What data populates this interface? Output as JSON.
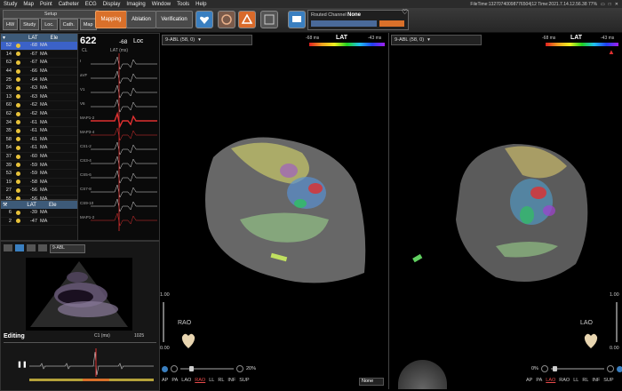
{
  "menu": [
    "Study",
    "Map",
    "Point",
    "Catheter",
    "ECG",
    "Display",
    "Imaging",
    "Window",
    "Tools",
    "Help"
  ],
  "status": {
    "file_time": "FileTime:13270740098776504|12 Time:2021.7.14.12.56.38 77%"
  },
  "toolbar": {
    "setup": "Setup",
    "tabs": [
      "HW",
      "Study",
      "Loc.",
      "Cath.",
      "Map"
    ],
    "mapping": "Mapping",
    "ablation": "Ablation",
    "verification": "Verification",
    "routed_channel_label": "Routed Channel",
    "routed_channel_value": "None"
  },
  "list": {
    "headers": [
      "LAT",
      "Ele"
    ],
    "rows": [
      {
        "n": "52",
        "v": "-68",
        "t": "MA",
        "sel": true
      },
      {
        "n": "14",
        "v": "-67",
        "t": "MA"
      },
      {
        "n": "63",
        "v": "-67",
        "t": "MA"
      },
      {
        "n": "44",
        "v": "-66",
        "t": "MA"
      },
      {
        "n": "25",
        "v": "-64",
        "t": "MA"
      },
      {
        "n": "26",
        "v": "-63",
        "t": "MA"
      },
      {
        "n": "13",
        "v": "-63",
        "t": "MA"
      },
      {
        "n": "60",
        "v": "-62",
        "t": "MA"
      },
      {
        "n": "62",
        "v": "-62",
        "t": "MA"
      },
      {
        "n": "34",
        "v": "-61",
        "t": "MA"
      },
      {
        "n": "35",
        "v": "-61",
        "t": "MA"
      },
      {
        "n": "58",
        "v": "-61",
        "t": "MA"
      },
      {
        "n": "54",
        "v": "-61",
        "t": "MA"
      },
      {
        "n": "37",
        "v": "-60",
        "t": "MA"
      },
      {
        "n": "39",
        "v": "-59",
        "t": "MA"
      },
      {
        "n": "53",
        "v": "-59",
        "t": "MA"
      },
      {
        "n": "19",
        "v": "-58",
        "t": "MA"
      },
      {
        "n": "27",
        "v": "-56",
        "t": "MA"
      },
      {
        "n": "55",
        "v": "-56",
        "t": "MA"
      }
    ],
    "rows2": [
      {
        "n": "6",
        "v": "-39",
        "t": "MA"
      },
      {
        "n": "2",
        "v": "-47",
        "t": "MA"
      }
    ]
  },
  "ecg": {
    "cl": "622",
    "cl_label": "CL",
    "lat": "-68",
    "lat_label": "LAT (ms)",
    "loc": "Loc",
    "channels": [
      "I",
      "aVF",
      "V1",
      "V6",
      "MAP1-2",
      "MAP3-4",
      "CS1-2",
      "CS3-4",
      "CS5-6",
      "CS7-8",
      "CS9-10",
      "MAP1-2"
    ]
  },
  "views": {
    "left": {
      "catheter": "9-ABL (58, 0)",
      "min": "-68 ms",
      "label": "LAT",
      "max": "-43 ms",
      "orientation": "RAO",
      "zoom": "20%",
      "scale_top": "1.00",
      "scale_bottom": "0.00",
      "dropdown": "None"
    },
    "right": {
      "catheter": "9-ABL (58, 0)",
      "min": "-68 ms",
      "label": "LAT",
      "max": "-43 ms",
      "orientation": "LAO",
      "zoom": "0%",
      "scale_top": "1.00",
      "scale_bottom": "0.00"
    }
  },
  "orient_buttons": [
    "AP",
    "PA",
    "LAO",
    "RAO",
    "LL",
    "RL",
    "INF",
    "SUP"
  ],
  "ultrasound": {
    "catheter": "9-ABL",
    "editing": "Editing",
    "depth": "C1 (ms)",
    "value": "1025"
  },
  "colors": {
    "accent": "#e07a2a",
    "selected": "#3b62c8",
    "blue_header": "#3d5a78"
  }
}
